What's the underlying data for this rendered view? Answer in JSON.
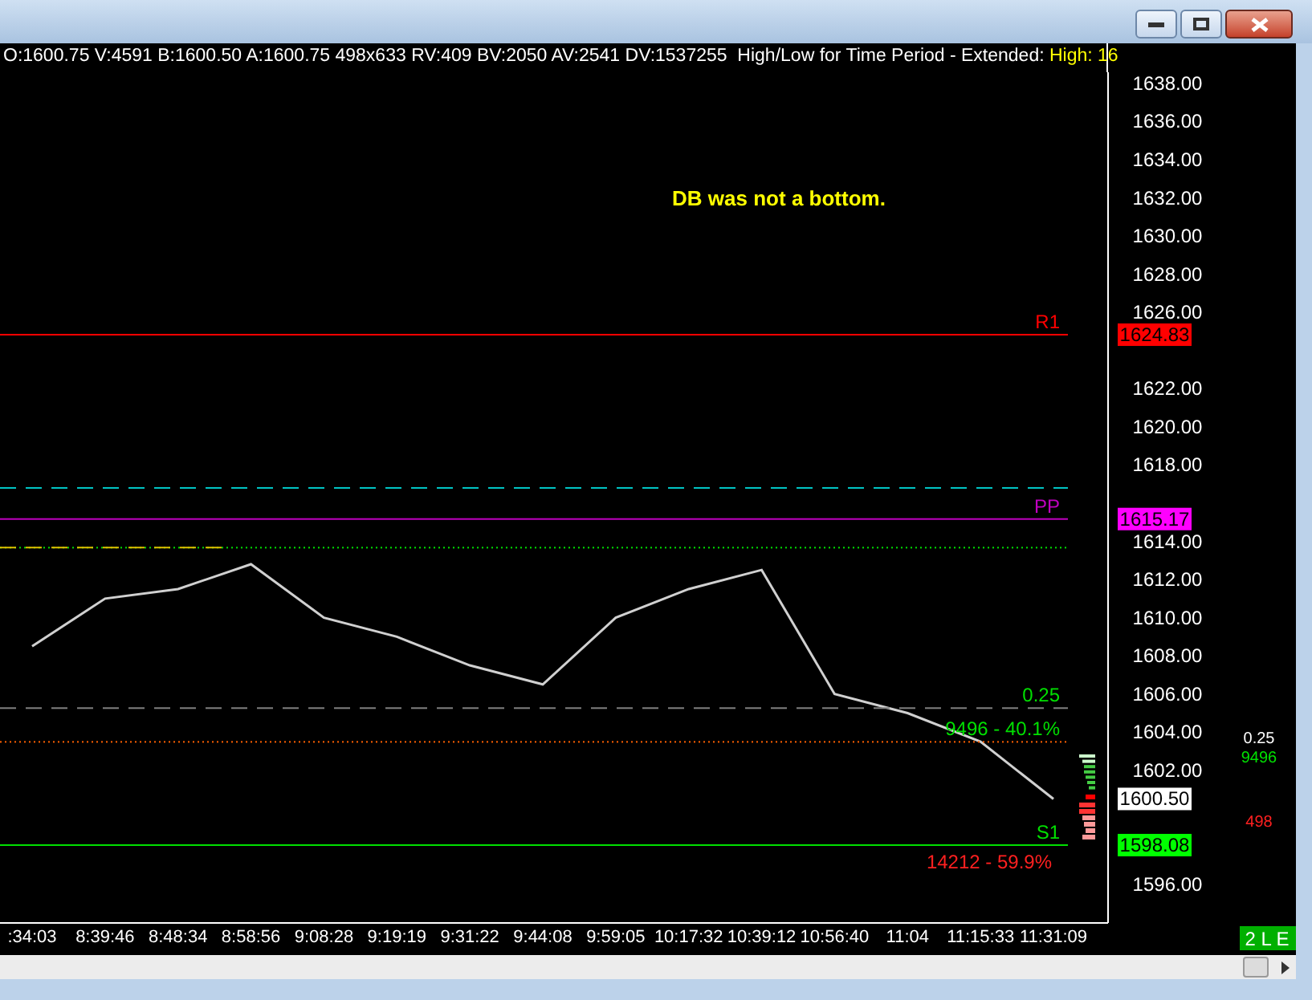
{
  "info_bar": {
    "text": "O:1600.75 V:4591 B:1600.50 A:1600.75 498x633 RV:409 BV:2050 AV:2541 DV:1537255  High/Low for Time Period - Extended: ",
    "highlight": "High: 16"
  },
  "chart": {
    "chart_data": {
      "type": "line",
      "categories": [
        ":34:03",
        "8:39:46",
        "8:48:34",
        "8:58:56",
        "9:08:28",
        "9:19:19",
        "9:31:22",
        "9:44:08",
        "9:59:05",
        "10:17:32",
        "10:39:12",
        "10:56:40",
        "11:04",
        "11:15:33",
        "11:31:09"
      ],
      "series": [
        {
          "color": "#d0d0d0",
          "values": [
            1608.5,
            1611,
            1611.5,
            1612.8,
            1610,
            1609,
            1607.5,
            1606.5,
            1610,
            1611.5,
            1612.5,
            1606,
            1605,
            1603.5,
            1600.5
          ]
        }
      ],
      "ylim": [
        1594,
        1640.1
      ],
      "yticks": [
        {
          "value": 1596,
          "label": "1596.00"
        },
        {
          "value": 1602,
          "label": "1602.00"
        },
        {
          "value": 1604,
          "label": "1604.00"
        },
        {
          "value": 1606,
          "label": "1606.00"
        },
        {
          "value": 1608,
          "label": "1608.00"
        },
        {
          "value": 1610,
          "label": "1610.00"
        },
        {
          "value": 1612,
          "label": "1612.00"
        },
        {
          "value": 1614,
          "label": "1614.00"
        },
        {
          "value": 1618,
          "label": "1618.00"
        },
        {
          "value": 1620,
          "label": "1620.00"
        },
        {
          "value": 1622,
          "label": "1622.00"
        },
        {
          "value": 1626,
          "label": "1626.00"
        },
        {
          "value": 1628,
          "label": "1628.00"
        },
        {
          "value": 1630,
          "label": "1630.00"
        },
        {
          "value": 1632,
          "label": "1632.00"
        },
        {
          "value": 1634,
          "label": "1634.00"
        },
        {
          "value": 1636,
          "label": "1636.00"
        },
        {
          "value": 1638,
          "label": "1638.00"
        }
      ],
      "annotations": [
        "DB was not a bottom.",
        "14212 - 59.9%"
      ]
    },
    "levels": [
      {
        "label": "R1",
        "color": "#ff0000"
      },
      {
        "color": "#00c8c8"
      },
      {
        "label": "PP",
        "color": "#c000c0"
      },
      {
        "color": "#00e000"
      },
      {
        "label": "0.25",
        "color": "#808080"
      },
      {
        "label": "9496 - 40.1%",
        "color": "#ff6000"
      },
      {
        "label": "S1",
        "color": "#00e000"
      }
    ],
    "price_tags": [
      {
        "text": "1624.83",
        "color": "#ff0000"
      },
      {
        "text": "1615.17",
        "color": "#ff00ff"
      },
      {
        "text": "1600.50",
        "color": "#ffffff"
      },
      {
        "text": "1598.08",
        "color": "#00ff00"
      }
    ],
    "side_labels": [
      {
        "text": "0.25",
        "color": "#ffffff"
      },
      {
        "text": "9496",
        "color": "#00e000"
      },
      {
        "text": "498",
        "color": "#ff2020"
      }
    ]
  },
  "status_badge": "2 L E"
}
